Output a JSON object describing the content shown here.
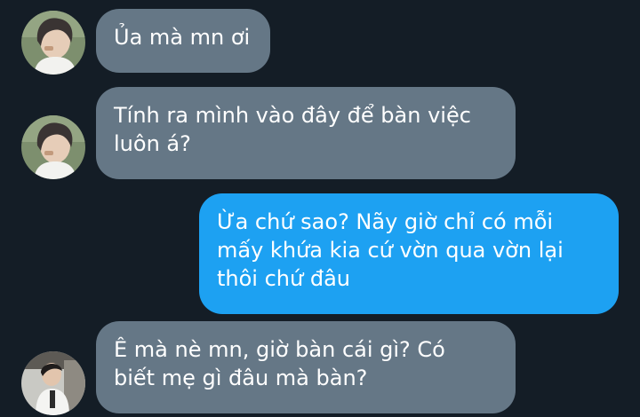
{
  "thread": {
    "messages": [
      {
        "sender": "incoming",
        "avatar_icon": "profile-photo-icon",
        "lines": [
          "Ủa mà mn ơi"
        ]
      },
      {
        "sender": "incoming",
        "avatar_icon": "profile-photo-icon",
        "lines": [
          "Tính ra mình vào đây để bàn việc",
          "luôn á?"
        ]
      },
      {
        "sender": "outgoing",
        "lines": [
          "Ừa chứ sao? Nãy giờ chỉ có mỗi",
          "mấy khứa kia cứ vờn qua vờn lại",
          "thôi chứ đâu"
        ]
      },
      {
        "sender": "incoming",
        "avatar_icon": "profile-photo-icon",
        "lines": [
          "Ê mà nè mn, giờ bàn cái gì? Có",
          "biết mẹ gì đâu mà bàn?"
        ]
      }
    ]
  },
  "colors": {
    "background": "#141d26",
    "incoming_bubble": "#657786",
    "outgoing_bubble": "#1da1f2",
    "text": "#ffffff"
  }
}
